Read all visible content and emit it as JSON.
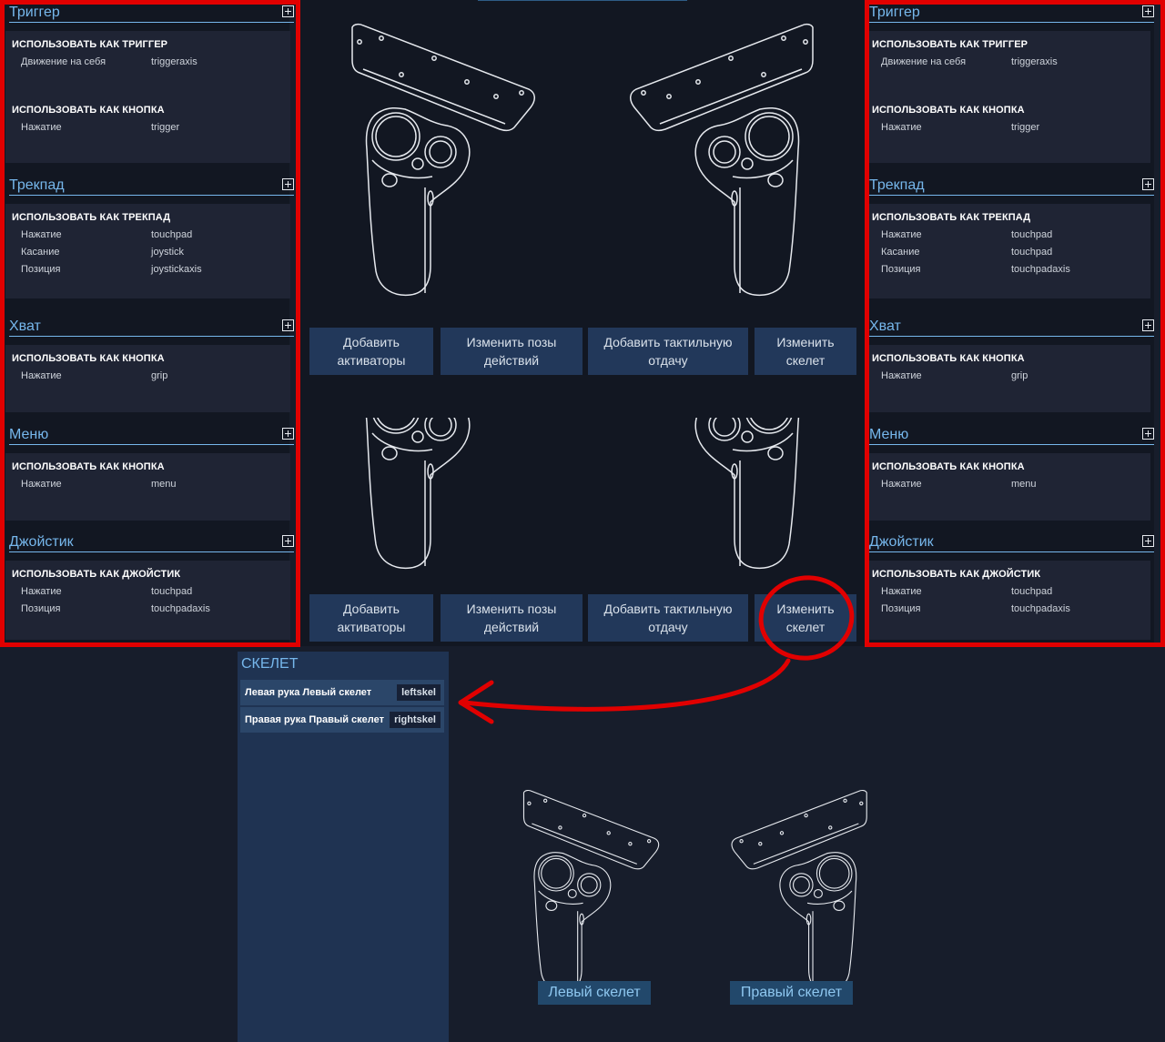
{
  "left_panel": {
    "sections": [
      {
        "title": "Триггер",
        "groups": [
          {
            "title": "ИСПОЛЬЗОВАТЬ КАК ТРИГГЕР",
            "rows": [
              {
                "k": "Движение на себя",
                "v": "triggeraxis"
              }
            ]
          },
          {
            "title": "ИСПОЛЬЗОВАТЬ КАК КНОПКА",
            "rows": [
              {
                "k": "Нажатие",
                "v": "trigger"
              }
            ]
          }
        ]
      },
      {
        "title": "Трекпад",
        "groups": [
          {
            "title": "ИСПОЛЬЗОВАТЬ КАК ТРЕКПАД",
            "rows": [
              {
                "k": "Нажатие",
                "v": "touchpad"
              },
              {
                "k": "Касание",
                "v": "joystick"
              },
              {
                "k": "Позиция",
                "v": "joystickaxis"
              }
            ]
          }
        ]
      },
      {
        "title": "Хват",
        "groups": [
          {
            "title": "ИСПОЛЬЗОВАТЬ КАК КНОПКА",
            "rows": [
              {
                "k": "Нажатие",
                "v": "grip"
              }
            ]
          }
        ]
      },
      {
        "title": "Меню",
        "groups": [
          {
            "title": "ИСПОЛЬЗОВАТЬ КАК КНОПКА",
            "rows": [
              {
                "k": "Нажатие",
                "v": "menu"
              }
            ]
          }
        ]
      },
      {
        "title": "Джойстик",
        "groups": [
          {
            "title": "ИСПОЛЬЗОВАТЬ КАК ДЖОЙСТИК",
            "rows": [
              {
                "k": "Нажатие",
                "v": "touchpad"
              },
              {
                "k": "Позиция",
                "v": "touchpadaxis"
              }
            ]
          }
        ]
      }
    ]
  },
  "right_panel": {
    "sections": [
      {
        "title": "Триггер",
        "groups": [
          {
            "title": "ИСПОЛЬЗОВАТЬ КАК ТРИГГЕР",
            "rows": [
              {
                "k": "Движение на себя",
                "v": "triggeraxis"
              }
            ]
          },
          {
            "title": "ИСПОЛЬЗОВАТЬ КАК КНОПКА",
            "rows": [
              {
                "k": "Нажатие",
                "v": "trigger"
              }
            ]
          }
        ]
      },
      {
        "title": "Трекпад",
        "groups": [
          {
            "title": "ИСПОЛЬЗОВАТЬ КАК ТРЕКПАД",
            "rows": [
              {
                "k": "Нажатие",
                "v": "touchpad"
              },
              {
                "k": "Касание",
                "v": "touchpad"
              },
              {
                "k": "Позиция",
                "v": "touchpadaxis"
              }
            ]
          }
        ]
      },
      {
        "title": "Хват",
        "groups": [
          {
            "title": "ИСПОЛЬЗОВАТЬ КАК КНОПКА",
            "rows": [
              {
                "k": "Нажатие",
                "v": "grip"
              }
            ]
          }
        ]
      },
      {
        "title": "Меню",
        "groups": [
          {
            "title": "ИСПОЛЬЗОВАТЬ КАК КНОПКА",
            "rows": [
              {
                "k": "Нажатие",
                "v": "menu"
              }
            ]
          }
        ]
      },
      {
        "title": "Джойстик",
        "groups": [
          {
            "title": "ИСПОЛЬЗОВАТЬ КАК ДЖОЙСТИК",
            "rows": [
              {
                "k": "Нажатие",
                "v": "touchpad"
              },
              {
                "k": "Позиция",
                "v": "touchpadaxis"
              }
            ]
          }
        ]
      }
    ]
  },
  "actions_top": {
    "add_activators": "Добавить\nактиваторы",
    "edit_poses": "Изменить позы\nдействий",
    "add_haptics": "Добавить тактильную\nотдачу",
    "edit_skeleton": "Изменить\nскелет"
  },
  "actions_bottom": {
    "add_activators": "Добавить\nактиваторы",
    "edit_poses": "Изменить позы\nдействий",
    "add_haptics": "Добавить тактильную\nотдачу",
    "edit_skeleton": "Изменить\nскелет"
  },
  "skeleton": {
    "title": "СКЕЛЕТ",
    "rows": [
      {
        "label": "Левая рука Левый скелет",
        "value": "leftskel"
      },
      {
        "label": "Правая рука Правый скелет",
        "value": "rightskel"
      }
    ],
    "left_label": "Левый скелет",
    "right_label": "Правый скелет"
  },
  "colors": {
    "accent": "#76b7ec",
    "highlight": "#e10000",
    "button": "#22385a",
    "panel": "#1f2434"
  }
}
